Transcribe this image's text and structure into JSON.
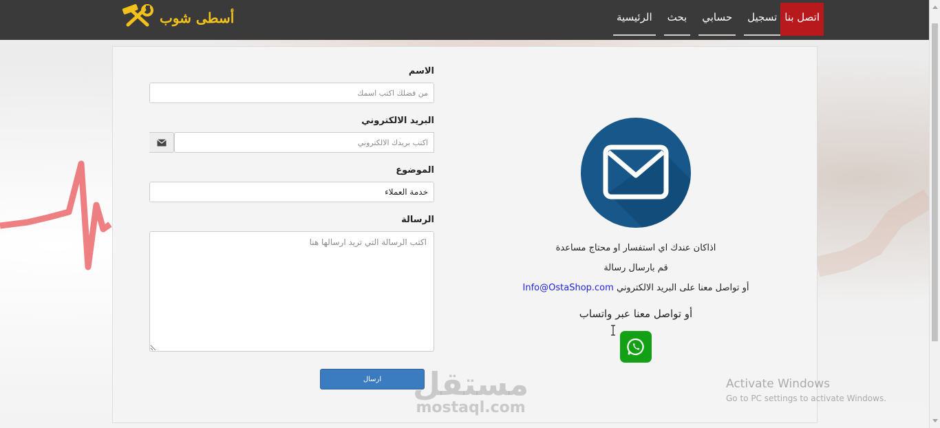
{
  "brand": {
    "logo_text": "أسطى شوب"
  },
  "nav": {
    "items": [
      {
        "label": "الرئيسية"
      },
      {
        "label": "بحث"
      },
      {
        "label": "حسابي"
      },
      {
        "label": "تسجيل"
      },
      {
        "label": "اتصل بنا",
        "active": true
      }
    ]
  },
  "form": {
    "name": {
      "label": "الاسم",
      "placeholder": "من فضلك اكتب اسمك",
      "value": ""
    },
    "email": {
      "label": "البريد الالكتروني",
      "placeholder": "اكتب بريدك الالكتروني",
      "value": "",
      "icon": "envelope-icon"
    },
    "subject": {
      "label": "الموضوع",
      "value": "خدمة العملاء"
    },
    "message": {
      "label": "الرسالة",
      "placeholder": "اكتب الرسالة التي تريد ارسالها هنا",
      "value": ""
    },
    "submit_label": "ارسال"
  },
  "info": {
    "icon": "envelope-icon",
    "line1": "اذاكان عندك اي استفسار او محتاج مساعدة",
    "line2": "قم بارسال رسالة",
    "line3_prefix": "أو تواصل معنا على البريد الالكتروني",
    "email": "Info@OstaShop.com",
    "whatsapp_text": "أو تواصل معنا عبر واتساب",
    "whatsapp_icon": "whatsapp-icon"
  },
  "watermark": {
    "arabic": "مستقل",
    "latin": "mostaql.com"
  },
  "windows_activation": {
    "title": "Activate Windows",
    "subtitle": "Go to PC settings to activate Windows."
  },
  "colors": {
    "navbar": "#3a3a3a",
    "active_nav": "#b8191d",
    "brand_yellow": "#f2c21b",
    "mail_circle": "#17578a",
    "submit": "#3b7bbf",
    "whatsapp": "#14a014"
  }
}
